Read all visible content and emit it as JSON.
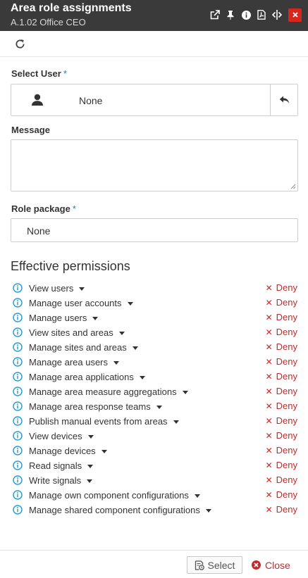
{
  "window": {
    "title": "Area role assignments",
    "subtitle": "A.1.02 Office CEO",
    "icons": [
      "external-link-icon",
      "pin-icon",
      "info-icon",
      "pdf-icon",
      "resize-horizontal-icon",
      "close-icon"
    ]
  },
  "toolbar": {
    "refresh_icon": "refresh-icon"
  },
  "form": {
    "select_user": {
      "label": "Select User",
      "required_mark": "*",
      "value": "None"
    },
    "message": {
      "label": "Message",
      "value": ""
    },
    "role_package": {
      "label": "Role package",
      "required_mark": "*",
      "value": "None"
    }
  },
  "permissions": {
    "heading": "Effective permissions",
    "items": [
      {
        "label": "View users",
        "status": "Deny"
      },
      {
        "label": "Manage user accounts",
        "status": "Deny"
      },
      {
        "label": "Manage users",
        "status": "Deny"
      },
      {
        "label": "View sites and areas",
        "status": "Deny"
      },
      {
        "label": "Manage sites and areas",
        "status": "Deny"
      },
      {
        "label": "Manage area users",
        "status": "Deny"
      },
      {
        "label": "Manage area applications",
        "status": "Deny"
      },
      {
        "label": "Manage area measure aggregations",
        "status": "Deny"
      },
      {
        "label": "Manage area response teams",
        "status": "Deny"
      },
      {
        "label": "Publish manual events from areas",
        "status": "Deny"
      },
      {
        "label": "View devices",
        "status": "Deny"
      },
      {
        "label": "Manage devices",
        "status": "Deny"
      },
      {
        "label": "Read signals",
        "status": "Deny"
      },
      {
        "label": "Write signals",
        "status": "Deny"
      },
      {
        "label": "Manage own component configurations",
        "status": "Deny"
      },
      {
        "label": "Manage shared component configurations",
        "status": "Deny"
      }
    ]
  },
  "footer": {
    "select_label": "Select",
    "close_label": "Close"
  },
  "colors": {
    "titlebar": "#3a3a3a",
    "close_red": "#d9261c",
    "deny_red": "#c42a2a",
    "info_blue": "#2a9fd6",
    "required_blue": "#1a7fc1"
  }
}
